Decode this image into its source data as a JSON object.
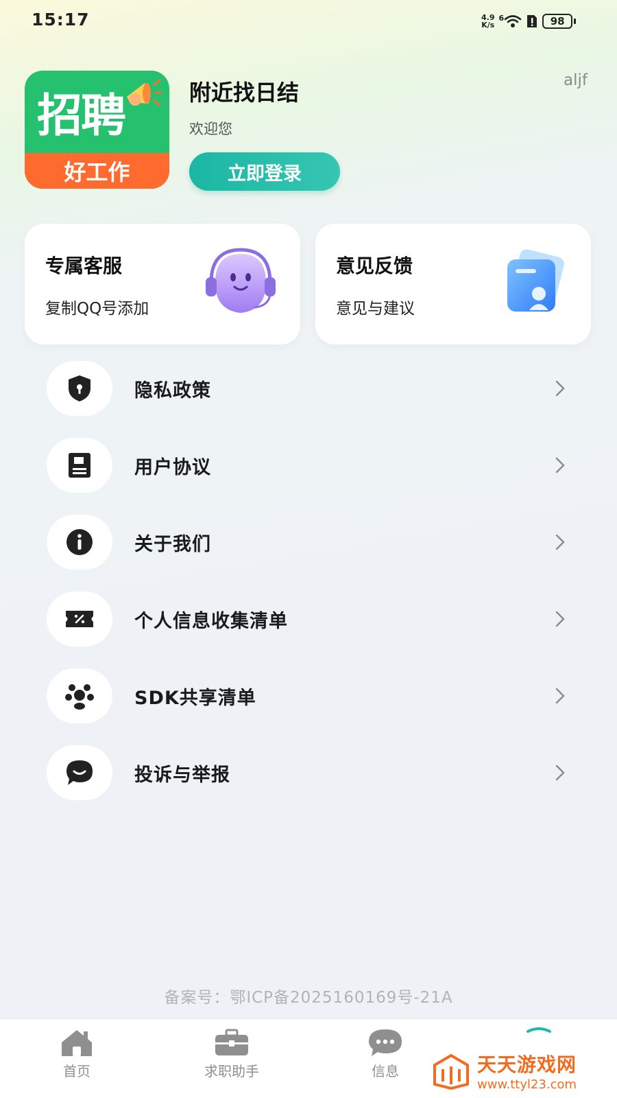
{
  "status_bar": {
    "time": "15:17",
    "net_speed_value": "4.9",
    "net_speed_unit": "K/s",
    "signal_label": "6",
    "battery": "98"
  },
  "header": {
    "logo_main": "招聘",
    "logo_sub": "好工作",
    "app_name": "附近找日结",
    "welcome": "欢迎您",
    "login_label": "立即登录",
    "user_id": "aljf"
  },
  "cards": [
    {
      "title": "专属客服",
      "subtitle": "复制QQ号添加",
      "icon": "headset-mascot-icon"
    },
    {
      "title": "意见反馈",
      "subtitle": "意见与建议",
      "icon": "feedback-folder-icon"
    }
  ],
  "menu": [
    {
      "label": "隐私政策",
      "icon": "shield-lock-icon"
    },
    {
      "label": "用户协议",
      "icon": "document-icon"
    },
    {
      "label": "关于我们",
      "icon": "info-icon"
    },
    {
      "label": "个人信息收集清单",
      "icon": "ticket-icon"
    },
    {
      "label": "SDK共享清单",
      "icon": "share-cluster-icon"
    },
    {
      "label": "投诉与举报",
      "icon": "chat-bubble-icon"
    }
  ],
  "icp": "备案号：鄂ICP备2025160169号-21A",
  "tabs": [
    {
      "label": "首页",
      "icon": "home-icon"
    },
    {
      "label": "求职助手",
      "icon": "briefcase-icon"
    },
    {
      "label": "信息",
      "icon": "message-icon"
    },
    {
      "label": "",
      "icon": "profile-icon"
    }
  ],
  "watermark": {
    "title": "天天游戏网",
    "url": "www.ttyl23.com"
  },
  "colors": {
    "accent": "#1fb8a6",
    "logo_green": "#25c16f",
    "logo_orange": "#ff6a2e",
    "watermark": "#f36b21"
  }
}
